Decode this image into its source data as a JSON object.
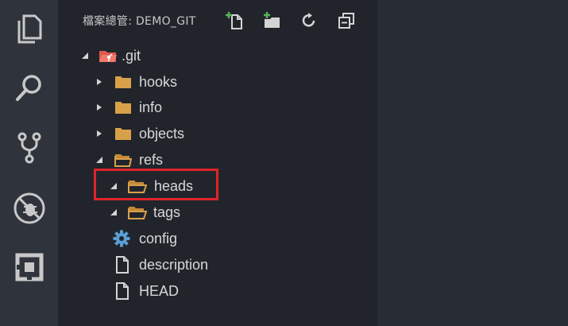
{
  "explorer": {
    "title": "檔案總管: DEMO_GIT",
    "actions": [
      {
        "name": "new-file-icon"
      },
      {
        "name": "new-folder-icon"
      },
      {
        "name": "refresh-icon"
      },
      {
        "name": "collapse-all-icon"
      }
    ]
  },
  "activity_bar": [
    "files-icon",
    "search-icon",
    "source-control-icon",
    "debug-icon",
    "extensions-icon"
  ],
  "tree": {
    "git": ".git",
    "hooks": "hooks",
    "info": "info",
    "objects": "objects",
    "refs": "refs",
    "heads": "heads",
    "tags": "tags",
    "config": "config",
    "description": "description",
    "HEAD": "HEAD"
  },
  "colors": {
    "highlight": "#e0232a",
    "folder": "#d9a04a",
    "git_folder": "#e05a4e",
    "gear": "#5a9fd4"
  }
}
